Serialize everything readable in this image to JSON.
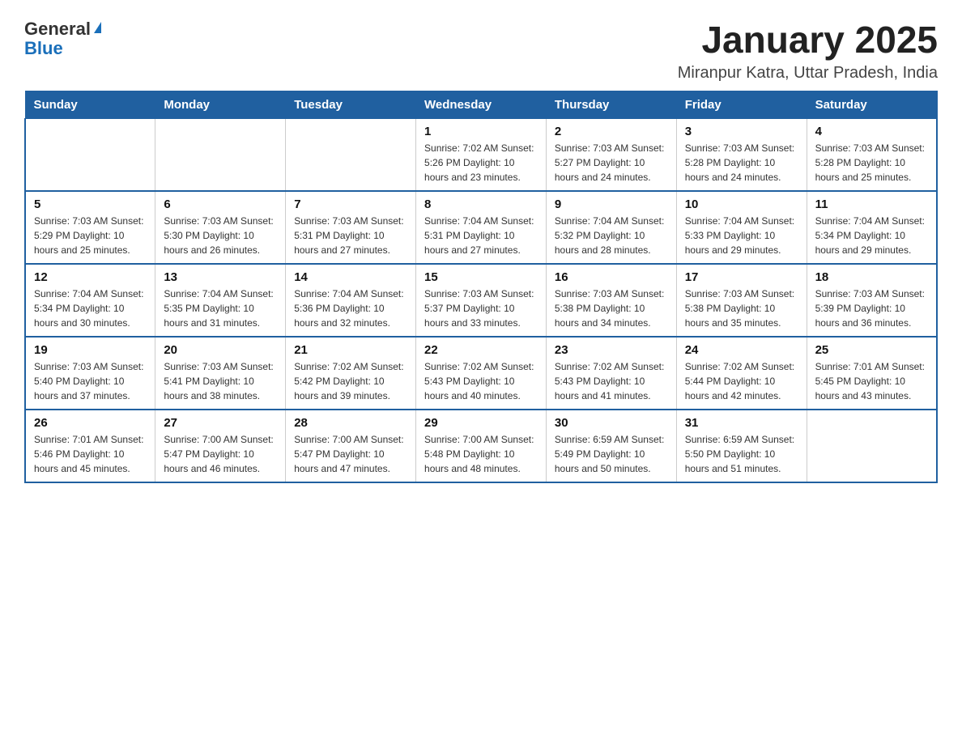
{
  "header": {
    "logo_general": "General",
    "logo_blue": "Blue",
    "title": "January 2025",
    "subtitle": "Miranpur Katra, Uttar Pradesh, India"
  },
  "days_of_week": [
    "Sunday",
    "Monday",
    "Tuesday",
    "Wednesday",
    "Thursday",
    "Friday",
    "Saturday"
  ],
  "weeks": [
    [
      {
        "day": "",
        "info": ""
      },
      {
        "day": "",
        "info": ""
      },
      {
        "day": "",
        "info": ""
      },
      {
        "day": "1",
        "info": "Sunrise: 7:02 AM\nSunset: 5:26 PM\nDaylight: 10 hours and 23 minutes."
      },
      {
        "day": "2",
        "info": "Sunrise: 7:03 AM\nSunset: 5:27 PM\nDaylight: 10 hours and 24 minutes."
      },
      {
        "day": "3",
        "info": "Sunrise: 7:03 AM\nSunset: 5:28 PM\nDaylight: 10 hours and 24 minutes."
      },
      {
        "day": "4",
        "info": "Sunrise: 7:03 AM\nSunset: 5:28 PM\nDaylight: 10 hours and 25 minutes."
      }
    ],
    [
      {
        "day": "5",
        "info": "Sunrise: 7:03 AM\nSunset: 5:29 PM\nDaylight: 10 hours and 25 minutes."
      },
      {
        "day": "6",
        "info": "Sunrise: 7:03 AM\nSunset: 5:30 PM\nDaylight: 10 hours and 26 minutes."
      },
      {
        "day": "7",
        "info": "Sunrise: 7:03 AM\nSunset: 5:31 PM\nDaylight: 10 hours and 27 minutes."
      },
      {
        "day": "8",
        "info": "Sunrise: 7:04 AM\nSunset: 5:31 PM\nDaylight: 10 hours and 27 minutes."
      },
      {
        "day": "9",
        "info": "Sunrise: 7:04 AM\nSunset: 5:32 PM\nDaylight: 10 hours and 28 minutes."
      },
      {
        "day": "10",
        "info": "Sunrise: 7:04 AM\nSunset: 5:33 PM\nDaylight: 10 hours and 29 minutes."
      },
      {
        "day": "11",
        "info": "Sunrise: 7:04 AM\nSunset: 5:34 PM\nDaylight: 10 hours and 29 minutes."
      }
    ],
    [
      {
        "day": "12",
        "info": "Sunrise: 7:04 AM\nSunset: 5:34 PM\nDaylight: 10 hours and 30 minutes."
      },
      {
        "day": "13",
        "info": "Sunrise: 7:04 AM\nSunset: 5:35 PM\nDaylight: 10 hours and 31 minutes."
      },
      {
        "day": "14",
        "info": "Sunrise: 7:04 AM\nSunset: 5:36 PM\nDaylight: 10 hours and 32 minutes."
      },
      {
        "day": "15",
        "info": "Sunrise: 7:03 AM\nSunset: 5:37 PM\nDaylight: 10 hours and 33 minutes."
      },
      {
        "day": "16",
        "info": "Sunrise: 7:03 AM\nSunset: 5:38 PM\nDaylight: 10 hours and 34 minutes."
      },
      {
        "day": "17",
        "info": "Sunrise: 7:03 AM\nSunset: 5:38 PM\nDaylight: 10 hours and 35 minutes."
      },
      {
        "day": "18",
        "info": "Sunrise: 7:03 AM\nSunset: 5:39 PM\nDaylight: 10 hours and 36 minutes."
      }
    ],
    [
      {
        "day": "19",
        "info": "Sunrise: 7:03 AM\nSunset: 5:40 PM\nDaylight: 10 hours and 37 minutes."
      },
      {
        "day": "20",
        "info": "Sunrise: 7:03 AM\nSunset: 5:41 PM\nDaylight: 10 hours and 38 minutes."
      },
      {
        "day": "21",
        "info": "Sunrise: 7:02 AM\nSunset: 5:42 PM\nDaylight: 10 hours and 39 minutes."
      },
      {
        "day": "22",
        "info": "Sunrise: 7:02 AM\nSunset: 5:43 PM\nDaylight: 10 hours and 40 minutes."
      },
      {
        "day": "23",
        "info": "Sunrise: 7:02 AM\nSunset: 5:43 PM\nDaylight: 10 hours and 41 minutes."
      },
      {
        "day": "24",
        "info": "Sunrise: 7:02 AM\nSunset: 5:44 PM\nDaylight: 10 hours and 42 minutes."
      },
      {
        "day": "25",
        "info": "Sunrise: 7:01 AM\nSunset: 5:45 PM\nDaylight: 10 hours and 43 minutes."
      }
    ],
    [
      {
        "day": "26",
        "info": "Sunrise: 7:01 AM\nSunset: 5:46 PM\nDaylight: 10 hours and 45 minutes."
      },
      {
        "day": "27",
        "info": "Sunrise: 7:00 AM\nSunset: 5:47 PM\nDaylight: 10 hours and 46 minutes."
      },
      {
        "day": "28",
        "info": "Sunrise: 7:00 AM\nSunset: 5:47 PM\nDaylight: 10 hours and 47 minutes."
      },
      {
        "day": "29",
        "info": "Sunrise: 7:00 AM\nSunset: 5:48 PM\nDaylight: 10 hours and 48 minutes."
      },
      {
        "day": "30",
        "info": "Sunrise: 6:59 AM\nSunset: 5:49 PM\nDaylight: 10 hours and 50 minutes."
      },
      {
        "day": "31",
        "info": "Sunrise: 6:59 AM\nSunset: 5:50 PM\nDaylight: 10 hours and 51 minutes."
      },
      {
        "day": "",
        "info": ""
      }
    ]
  ]
}
